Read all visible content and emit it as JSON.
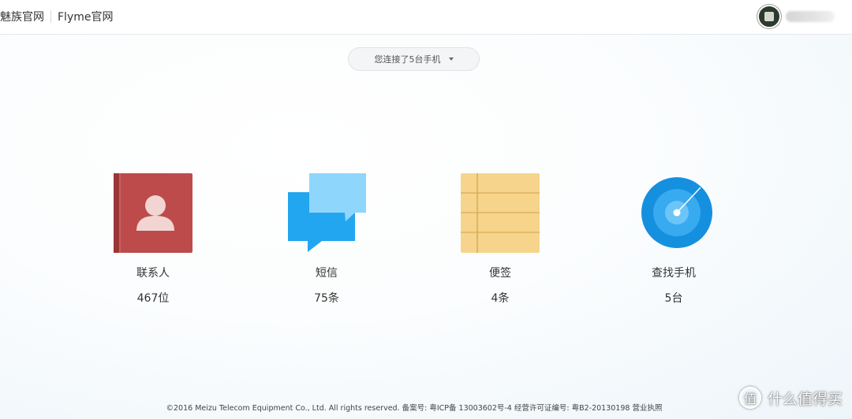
{
  "header": {
    "brand_meizu": "魅族官网",
    "brand_flyme": "Flyme官网"
  },
  "device_selector": {
    "label": "您连接了5台手机"
  },
  "tiles": [
    {
      "label": "联系人",
      "count": "467位",
      "icon": "contacts-icon",
      "color": "#b94a4a"
    },
    {
      "label": "短信",
      "count": "75条",
      "icon": "messages-icon",
      "color": "#1fa5ef"
    },
    {
      "label": "便签",
      "count": "4条",
      "icon": "notes-icon",
      "color": "#f6d38c"
    },
    {
      "label": "查找手机",
      "count": "5台",
      "icon": "find-phone-icon",
      "color": "#1592e0"
    }
  ],
  "footer": {
    "text": "©2016 Meizu Telecom Equipment Co., Ltd. All rights reserved. 备案号: 粤ICP备 13003602号-4 经营许可证编号: 粤B2-20130198 营业执照"
  },
  "watermark": {
    "glyph": "值",
    "text": "什么值得买"
  }
}
